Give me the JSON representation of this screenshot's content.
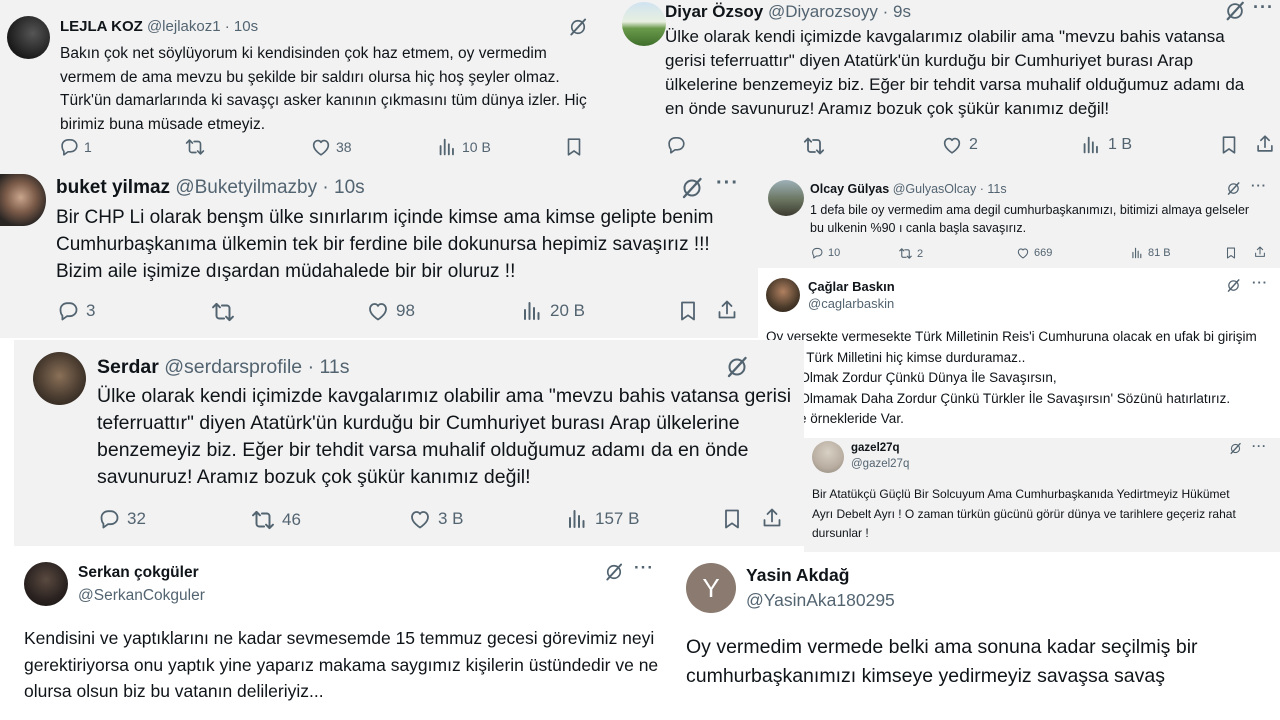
{
  "tweets": [
    {
      "name": "LEJLA KOZ",
      "handle": "@lejlakoz1",
      "sep": "·",
      "time": "10s",
      "text": "Bakın çok net söylüyorum ki kendisinden çok haz etmem, oy vermedim vermem de ama mevzu bu şekilde bir saldırı olursa hiç hoş şeyler olmaz. Türk'ün damarlarında ki savaşçı asker kanının çıkmasını tüm dünya izler. Hiç birimiz buna müsade etmeyiz.",
      "replies": "1",
      "retweets": "",
      "likes": "38",
      "views": "10 B"
    },
    {
      "name": "Diyar Özsoy",
      "handle": "@Diyarozsoyy",
      "sep": "·",
      "time": "9s",
      "text": "Ülke olarak kendi içimizde kavgalarımız olabilir ama \"mevzu bahis vatansa gerisi teferruattır\" diyen Atatürk'ün kurduğu bir Cumhuriyet burası Arap ülkelerine benzemeyiz biz. Eğer bir tehdit varsa muhalif olduğumuz adamı da en önde savunuruz! Aramız bozuk çok şükür kanımız değil!",
      "replies": "",
      "retweets": "",
      "likes": "2",
      "views": "1 B"
    },
    {
      "name": "buket yilmaz",
      "handle": "@Buketyilmazby",
      "sep": "·",
      "time": "10s",
      "text": "Bir CHP Li olarak benşm ülke sınırlarım içinde kimse ama kimse gelipte benim Cumhurbaşkanıma ülkemin tek bir ferdine bile dokunursa hepimiz savaşırız !!! Bizim aile işimize dışardan müdahalede bir bir oluruz !!",
      "replies": "3",
      "retweets": "",
      "likes": "98",
      "views": "20 B"
    },
    {
      "name": "Olcay Gülyas",
      "handle": "@GulyasOlcay",
      "sep": "·",
      "time": "11s",
      "text": "1 defa bile oy vermedim ama degil cumhurbaşkanımızı, bitimizi almaya gelseler bu ulkenin %90 ı canla başla savaşırız.",
      "replies": "10",
      "retweets": "2",
      "likes": "669",
      "views": "81 B"
    },
    {
      "name": "Çağlar Baskın",
      "handle": "@caglarbaskin",
      "text": "Oy versekte vermesekte Türk Milletinin Reis'i Cumhuruna olacak en ufak bi girişim olursa Türk Milletini hiç kimse durduramaz..\n'Türk Olmak Zordur Çünkü Dünya İle Savaşırsın,\n'Türk Olmamak Daha Zordur Çünkü Türkler İle Savaşırsın' Sözünü hatırlatırız. Tarihte örnekleride Var."
    },
    {
      "name": "Serdar",
      "handle": "@serdarsprofile",
      "sep": "·",
      "time": "11s",
      "text": "Ülke olarak kendi içimizde kavgalarımız olabilir ama \"mevzu bahis vatansa gerisi teferruattır\" diyen Atatürk'ün kurduğu bir Cumhuriyet burası Arap ülkelerine benzemeyiz biz. Eğer bir tehdit varsa muhalif olduğumuz adamı da en önde savunuruz! Aramız bozuk çok şükür kanımız değil!",
      "replies": "32",
      "retweets": "46",
      "likes": "3 B",
      "views": "157 B"
    },
    {
      "name": "gazel27q",
      "handle": "@gazel27q",
      "text": "Bir Atatükçü Güçlü  Bir Solcuyum Ama Cumhurbaşkanıda Yedirtmeyiz Hükümet Ayrı Debelt Ayrı ! O zaman türkün gücünü görür dünya ve tarihlere geçeriz rahat dursunlar !"
    },
    {
      "name": "Serkan çokgüler",
      "handle": "@SerkanCokguler",
      "text": "Kendisini ve yaptıklarını ne kadar sevmesemde 15 temmuz gecesi görevimiz neyi gerektiriyorsa onu yaptık yine yaparız makama saygımız kişilerin üstündedir ve ne olursa olsun biz bu vatanın delileriyiz..."
    },
    {
      "name": "Yasin Akdağ",
      "handle": "@YasinAka180295",
      "avatar_letter": "Y",
      "text": "Oy vermedim vermede belki ama sonuna kadar seçilmiş bir cumhurbaşkanımızı kimseye yedirmeyiz savaşsa savaş"
    }
  ],
  "colors": {
    "gray_bg": "#f2f2f2",
    "text": "#0f1419",
    "muted": "#536471",
    "avatar_letter_bg": "#8a7a70"
  }
}
